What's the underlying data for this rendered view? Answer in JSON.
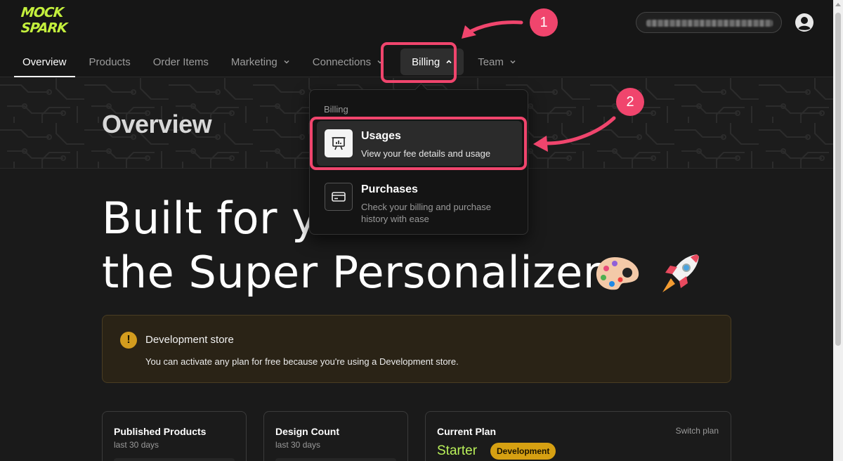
{
  "app": {
    "logo_line1": "MOCK",
    "logo_line2": "SPARK",
    "brand_color": "#c4f03d"
  },
  "nav": {
    "items": [
      {
        "label": "Overview",
        "active": true
      },
      {
        "label": "Products"
      },
      {
        "label": "Order Items"
      },
      {
        "label": "Marketing",
        "caret": "chevron-down-icon"
      },
      {
        "label": "Connections",
        "caret": "chevron-down-icon"
      },
      {
        "label": "Billing",
        "caret": "chevron-up-icon",
        "open": true
      },
      {
        "label": "Team",
        "caret": "chevron-down-icon"
      }
    ]
  },
  "header": {
    "account_icon": "user-circle-icon"
  },
  "page": {
    "title": "Overview",
    "hero_line1": "Built for y",
    "hero_line2": "the Super Personalizer"
  },
  "notice": {
    "icon": "!",
    "title": "Development store",
    "body": "You can activate any plan for free because you're using a Development store."
  },
  "cards": [
    {
      "title": "Published Products",
      "sub": "last 30 days"
    },
    {
      "title": "Design Count",
      "sub": "last 30 days"
    },
    {
      "title": "Current Plan",
      "action": "Switch plan",
      "plan": "Starter",
      "badge": "Development"
    }
  ],
  "dropdown": {
    "header": "Billing",
    "items": [
      {
        "title": "Usages",
        "desc": "View your fee details and usage",
        "icon": "chart-board-icon"
      },
      {
        "title": "Purchases",
        "desc": "Check your billing and purchase history with ease",
        "icon": "credit-card-icon"
      }
    ]
  },
  "annotations": {
    "step1": "1",
    "step2": "2",
    "color": "#f0456d"
  }
}
